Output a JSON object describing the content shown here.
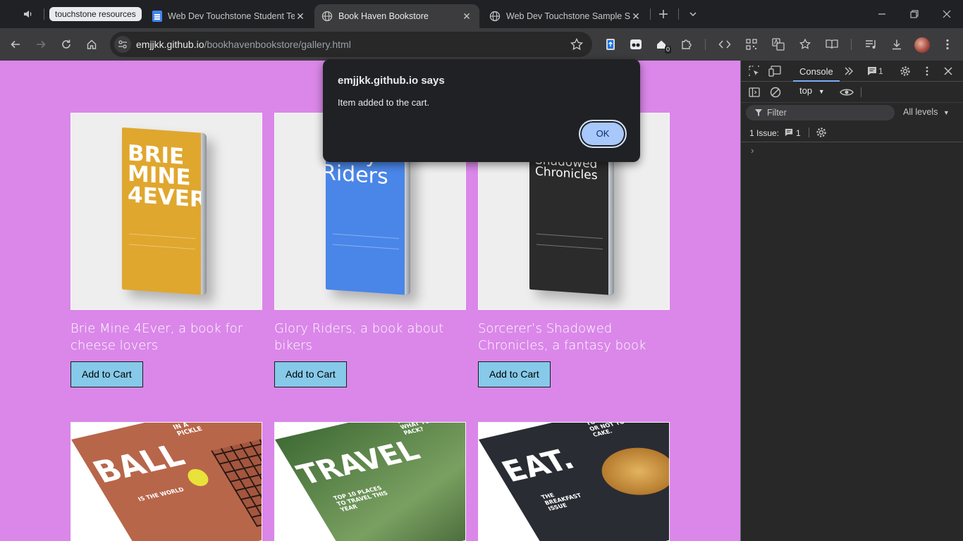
{
  "browser": {
    "tab_group_label": "touchstone resources",
    "tabs": [
      {
        "title": "Web Dev Touchstone Student Te",
        "icon": "docs-icon",
        "active": false
      },
      {
        "title": "Book Haven Bookstore",
        "icon": "globe-icon",
        "active": true
      },
      {
        "title": "Web Dev Touchstone Sample Si",
        "icon": "globe-icon",
        "active": false
      }
    ],
    "url_host": "emjjkk.github.io",
    "url_path": "/bookhavenbookstore/gallery.html",
    "extension_badge": "0"
  },
  "dialog": {
    "title": "emjjkk.github.io says",
    "message": "Item added to the cart.",
    "ok_label": "OK"
  },
  "gallery": {
    "books": [
      {
        "caption": "Brie Mine 4Ever, a book for cheese lovers",
        "cover_title": "BRIE MINE 4EVER",
        "cover_color": "#e0a72e",
        "button_label": "Add to Cart"
      },
      {
        "caption": "Glory Riders, a book about bikers",
        "cover_title": "Glory Riders",
        "cover_color": "#4a86e8",
        "button_label": "Add to Cart"
      },
      {
        "caption": "Sorcerer’s Shadowed Chronicles, a fantasy book",
        "cover_title": "Sorcerer's Shadowed Chronicles",
        "cover_color": "#2b2b2b",
        "button_label": "Add to Cart"
      }
    ],
    "magazines": [
      {
        "cover_title": "BALL",
        "side_text": "IN A PICKLE",
        "lower_text": "IS THE WORLD",
        "cover_color": "#b8664a"
      },
      {
        "cover_title": "TRAVEL",
        "side_text": "NOT SURE WHAT TO PACK?",
        "lower_text": "TOP 10 PLACES TO TRAVEL THIS YEAR",
        "cover_color": "#3f6b35"
      },
      {
        "cover_title": "EAT.",
        "side_text": "TO CAKE OR NOT TO CAKE.",
        "lower_text": "THE BREAKFAST ISSUE",
        "cover_color": "#2a2c33"
      }
    ]
  },
  "devtools": {
    "active_tab": "Console",
    "issue_badge_count": "1",
    "context": "top",
    "filter_placeholder": "Filter",
    "levels_label": "All levels",
    "issues_text": "1 Issue:",
    "issues_count": "1"
  }
}
